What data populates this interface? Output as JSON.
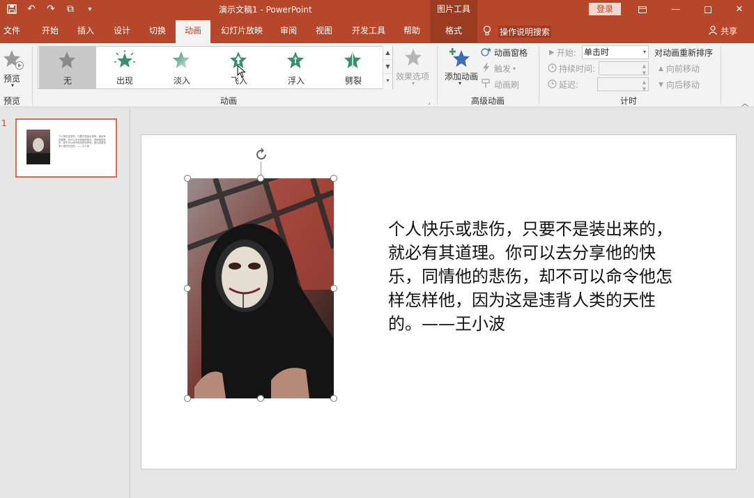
{
  "app": {
    "title": "演示文稿1 - PowerPoint",
    "context_tools": "图片工具",
    "login": "登录"
  },
  "tabs": [
    {
      "label": "文件"
    },
    {
      "label": "开始"
    },
    {
      "label": "插入"
    },
    {
      "label": "设计"
    },
    {
      "label": "切换"
    },
    {
      "label": "动画"
    },
    {
      "label": "幻灯片放映"
    },
    {
      "label": "审阅"
    },
    {
      "label": "视图"
    },
    {
      "label": "开发工具"
    },
    {
      "label": "帮助"
    },
    {
      "label": "格式"
    }
  ],
  "active_tab": "动画",
  "search_label": "操作说明搜索",
  "share_label": "共享",
  "ribbon": {
    "preview": {
      "button": "预览",
      "group": "预览"
    },
    "animations": {
      "group": "动画",
      "items": [
        {
          "label": "无",
          "icon": "star-gray-icon"
        },
        {
          "label": "出现",
          "icon": "star-burst-icon"
        },
        {
          "label": "淡入",
          "icon": "star-fade-icon"
        },
        {
          "label": "飞入",
          "icon": "star-fly-icon"
        },
        {
          "label": "浮入",
          "icon": "star-float-icon"
        },
        {
          "label": "劈裂",
          "icon": "star-split-icon"
        }
      ],
      "effect_options": "效果选项"
    },
    "advanced": {
      "group": "高级动画",
      "add": "添加动画",
      "pane": "动画窗格",
      "trigger": "触发",
      "painter": "动画刷"
    },
    "timing": {
      "group": "计时",
      "start_label": "开始:",
      "start_value": "单击时",
      "duration_label": "持续时间:",
      "delay_label": "延迟:",
      "reorder_title": "对动画重新排序",
      "move_earlier": "向前移动",
      "move_later": "向后移动"
    }
  },
  "slide_panel": {
    "slide_number": "1",
    "thumb_text": "个人快乐或悲伤，只要不是装出来的，就必有其道理。你可以去分享他的快乐，同情他的悲伤，却不可以命令他怎样怎样他，因为这是违背人类的天性的。——王小波"
  },
  "slide": {
    "quote": "个人快乐或悲伤，只要不是装出来的，就必有其道理。你可以去分享他的快乐，同情他的悲伤，却不可以命令他怎样怎样他，因为这是违背人类的天性的。——王小波"
  },
  "colors": {
    "brand": "#b7472a",
    "context": "#9a3b22",
    "selection": "#e0684b"
  }
}
